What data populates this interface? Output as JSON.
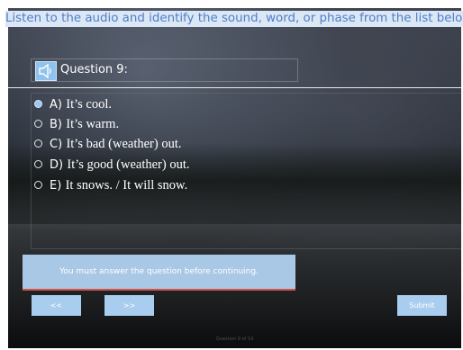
{
  "instruction": "Listen to the audio and identify the sound, word, or phase from the list below.",
  "question": {
    "label": "Question 9:",
    "audio_icon": "speaker-icon"
  },
  "options": [
    {
      "letter": "A)",
      "text": "It’s cool.",
      "selected": true
    },
    {
      "letter": "B)",
      "text": "It’s warm.",
      "selected": false
    },
    {
      "letter": "C)",
      "text": "It’s bad (weather) out.",
      "selected": false
    },
    {
      "letter": "D)",
      "text": "It’s good (weather) out.",
      "selected": false
    },
    {
      "letter": "E)",
      "text": "It snows. / It will snow.",
      "selected": false
    }
  ],
  "message": "You must answer the question before continuing.",
  "nav": {
    "prev_label": "<<",
    "next_label": ">>",
    "submit_label": "Submit"
  },
  "footer": "Question 9 of 19",
  "colors": {
    "accent": "#a9cdee",
    "instruction_text": "#4e7fc7",
    "message_border": "#d2534a"
  }
}
